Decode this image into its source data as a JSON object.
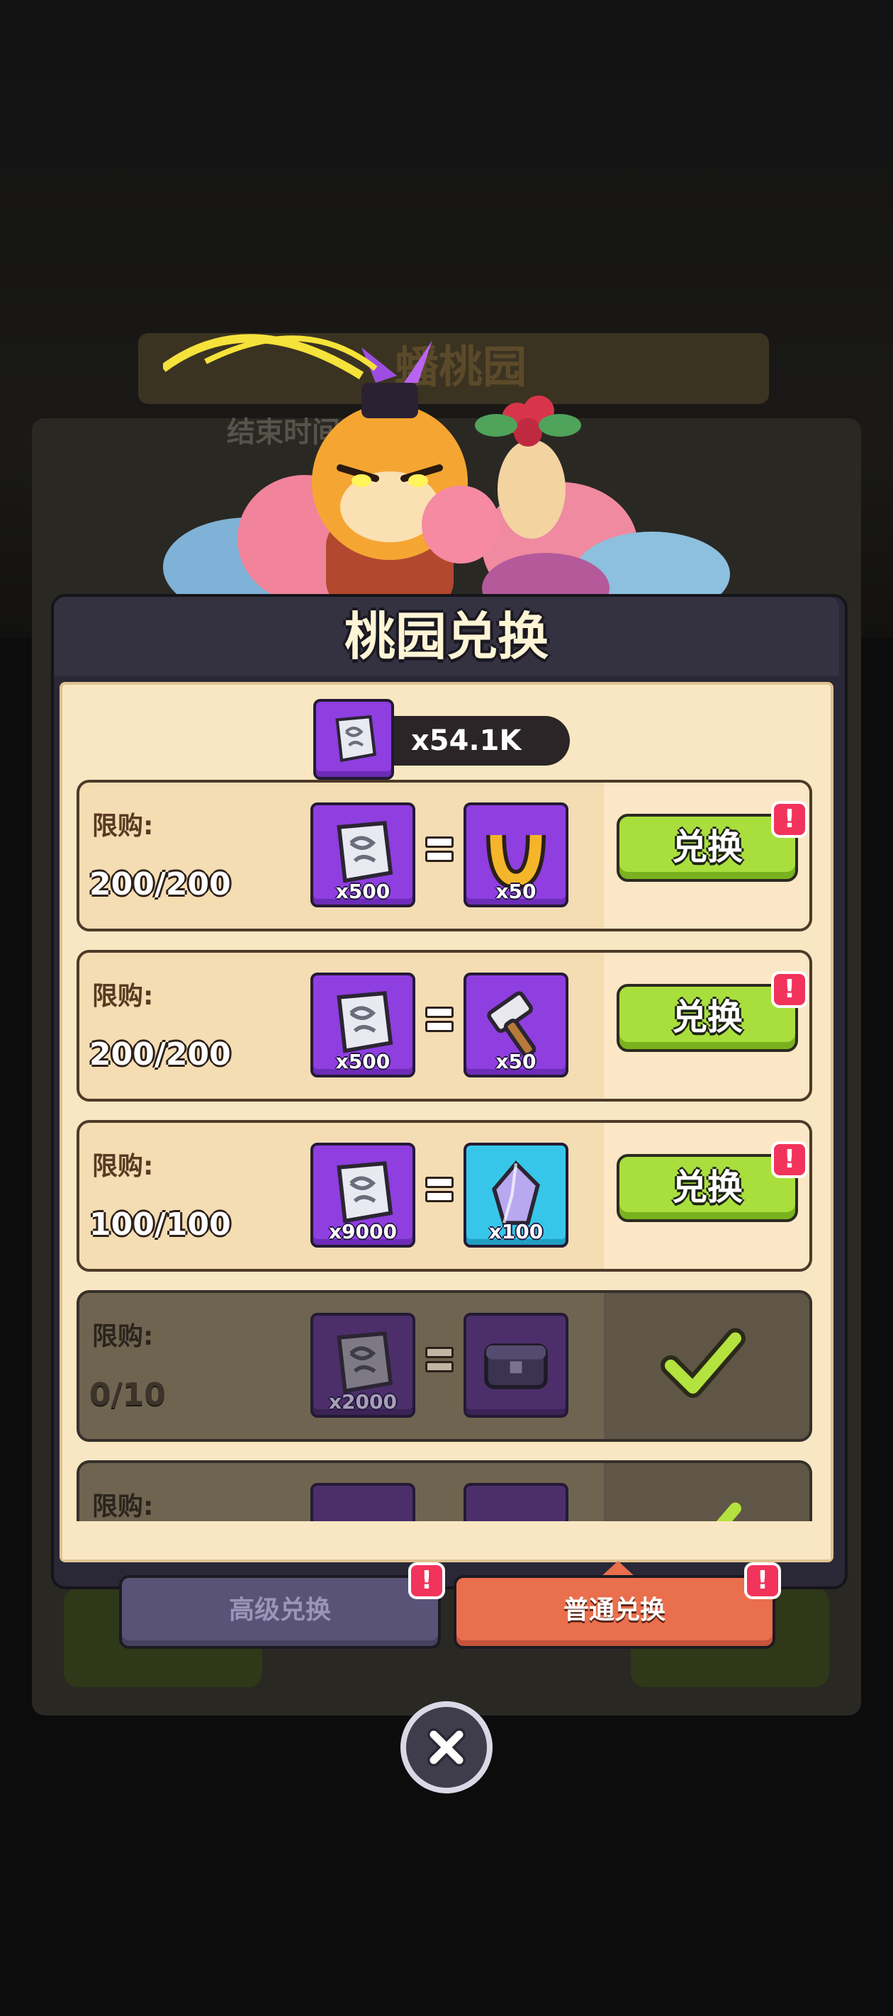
{
  "background": {
    "event_title": "蟠桃园",
    "timer_text": "结束时间 :18"
  },
  "modal": {
    "title": "桃园兑换",
    "currency_amount": "x54.1K",
    "currency_icon": "scroll-token-icon"
  },
  "rows": [
    {
      "limit_label": "限购:",
      "limit_count": "200/200",
      "cost_qty": "x500",
      "reward_qty": "x50",
      "reward_icon": "horseshoe-icon",
      "button": "兑换",
      "badge": "!",
      "state": "available"
    },
    {
      "limit_label": "限购:",
      "limit_count": "200/200",
      "cost_qty": "x500",
      "reward_qty": "x50",
      "reward_icon": "hammer-icon",
      "button": "兑换",
      "badge": "!",
      "state": "available"
    },
    {
      "limit_label": "限购:",
      "limit_count": "100/100",
      "cost_qty": "x9000",
      "reward_qty": "x100",
      "reward_icon": "crystal-icon",
      "button": "兑换",
      "badge": "!",
      "state": "available"
    },
    {
      "limit_label": "限购:",
      "limit_count": "0/10",
      "cost_qty": "x2000",
      "reward_qty": "",
      "reward_icon": "chest-icon",
      "state": "claimed"
    },
    {
      "limit_label": "限购:",
      "state": "claimed"
    }
  ],
  "tabs": {
    "advanced": "高级兑换",
    "normal": "普通兑换",
    "badge": "!"
  },
  "colors": {
    "accent_green": "#a9df3d",
    "tab_active": "#e96f4d",
    "tab_inactive": "#5a5378",
    "badge_red": "#f2335b",
    "panel_cream": "#f9e7c3"
  }
}
